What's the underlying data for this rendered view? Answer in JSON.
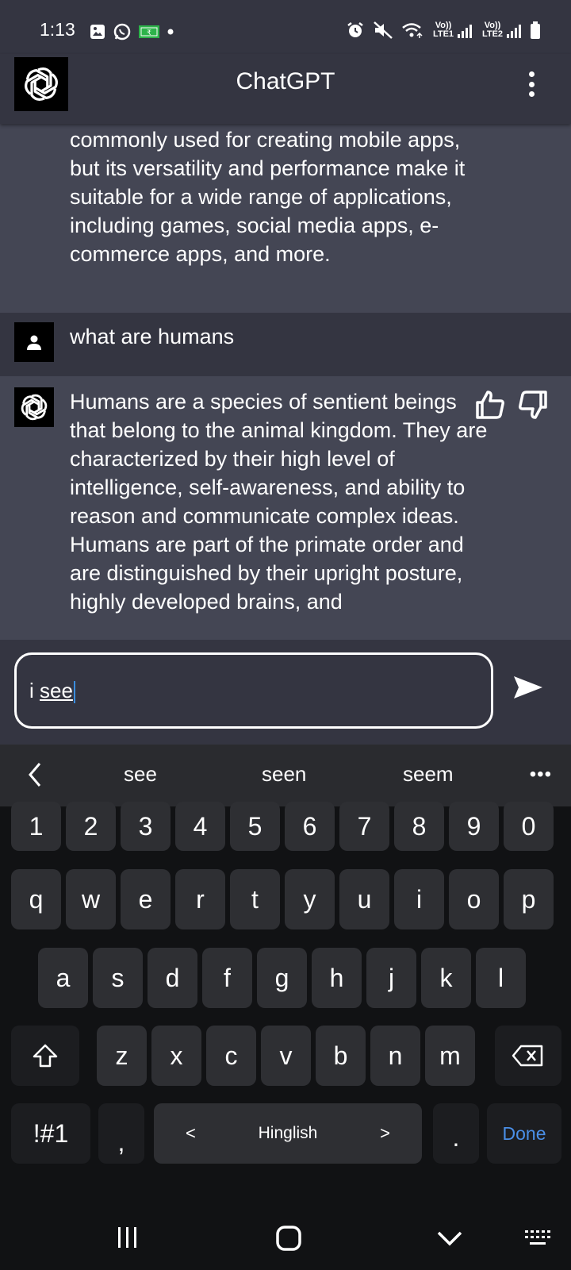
{
  "status_bar": {
    "time": "1:13",
    "sim1_label": "Vo)) LTE1",
    "sim2_label": "Vo)) LTE2"
  },
  "app_bar": {
    "title": "ChatGPT"
  },
  "chat": {
    "messages": [
      {
        "role": "assistant",
        "text": "commonly used for creating mobile apps, but its versatility and performance make it suitable for a wide range of applications, including games, social media apps, e-commerce apps, and more."
      },
      {
        "role": "user",
        "text": "what are humans"
      },
      {
        "role": "assistant",
        "text": "Humans are a species of sentient beings that belong to the animal kingdom. They are characterized by their high level of intelligence, self-awareness, and ability to reason and communicate complex ideas. Humans are part of the primate order and are distinguished by their upright posture, highly developed brains, and"
      }
    ]
  },
  "input": {
    "prefix": "i ",
    "underlined": "see"
  },
  "keyboard": {
    "suggestions": [
      "see",
      "seen",
      "seem"
    ],
    "row_numbers": [
      "1",
      "2",
      "3",
      "4",
      "5",
      "6",
      "7",
      "8",
      "9",
      "0"
    ],
    "row1": [
      "q",
      "w",
      "e",
      "r",
      "t",
      "y",
      "u",
      "i",
      "o",
      "p"
    ],
    "row2": [
      "a",
      "s",
      "d",
      "f",
      "g",
      "h",
      "j",
      "k",
      "l"
    ],
    "row3": [
      "z",
      "x",
      "c",
      "v",
      "b",
      "n",
      "m"
    ],
    "symbols_label": "!#1",
    "comma": ",",
    "space_label": "Hinglish",
    "space_left": "<",
    "space_right": ">",
    "period": ".",
    "done_label": "Done"
  },
  "colors": {
    "assistant_bg": "#444654",
    "user_bg": "#343541",
    "keyboard_bg": "#111214",
    "key_bg": "#2e2f33",
    "done_color": "#4a8fe7"
  }
}
